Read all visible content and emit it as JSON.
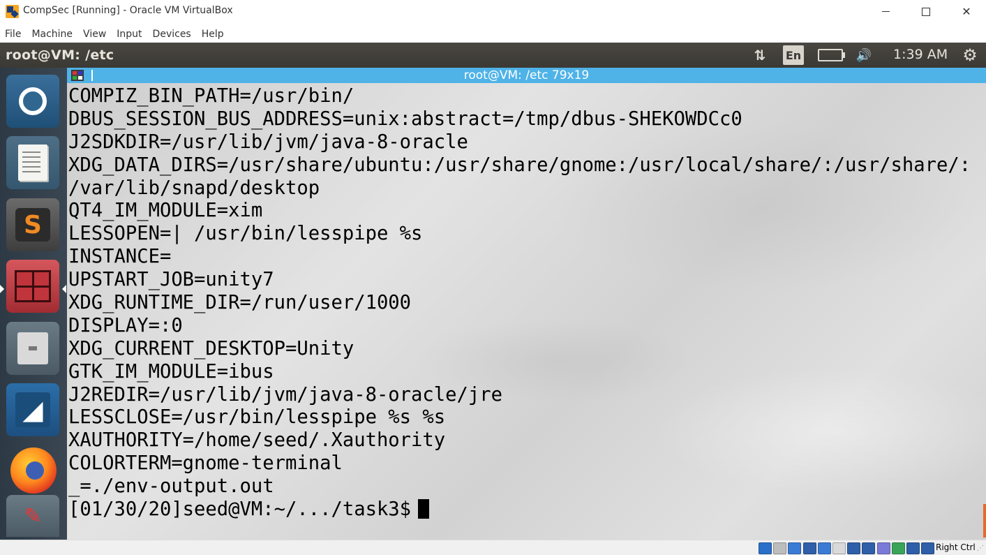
{
  "host_window": {
    "title": "CompSec [Running] - Oracle VM VirtualBox",
    "controls": {
      "minimize": "",
      "maximize": "",
      "close": "✕"
    }
  },
  "menubar": {
    "items": [
      "File",
      "Machine",
      "View",
      "Input",
      "Devices",
      "Help"
    ]
  },
  "ubuntu_panel": {
    "window_title": "root@VM: /etc",
    "network_glyph": "⇅",
    "language": "En",
    "volume_glyph": "🔊",
    "clock": "1:39 AM",
    "gear_glyph": "⚙"
  },
  "launcher": {
    "items": [
      {
        "name": "ubuntu-dash",
        "icon": "ubuntu-logo-icon"
      },
      {
        "name": "text-editor",
        "icon": "text-editor-icon"
      },
      {
        "name": "sublime-text",
        "icon": "sublime-text-icon",
        "glyph": "S"
      },
      {
        "name": "terminal",
        "icon": "terminal-icon",
        "active": true
      },
      {
        "name": "files",
        "icon": "files-icon"
      },
      {
        "name": "wireshark",
        "icon": "wireshark-icon"
      },
      {
        "name": "firefox",
        "icon": "firefox-icon"
      },
      {
        "name": "system-settings",
        "icon": "settings-icon"
      }
    ]
  },
  "terminal": {
    "title": "root@VM: /etc 79x19",
    "lines": [
      "COMPIZ_BIN_PATH=/usr/bin/",
      "DBUS_SESSION_BUS_ADDRESS=unix:abstract=/tmp/dbus-SHEKOWDCc0",
      "J2SDKDIR=/usr/lib/jvm/java-8-oracle",
      "XDG_DATA_DIRS=/usr/share/ubuntu:/usr/share/gnome:/usr/local/share/:/usr/share/:",
      "/var/lib/snapd/desktop",
      "QT4_IM_MODULE=xim",
      "LESSOPEN=| /usr/bin/lesspipe %s",
      "INSTANCE=",
      "UPSTART_JOB=unity7",
      "XDG_RUNTIME_DIR=/run/user/1000",
      "DISPLAY=:0",
      "XDG_CURRENT_DESKTOP=Unity",
      "GTK_IM_MODULE=ibus",
      "J2REDIR=/usr/lib/jvm/java-8-oracle/jre",
      "LESSCLOSE=/usr/bin/lesspipe %s %s",
      "XAUTHORITY=/home/seed/.Xauthority",
      "COLORTERM=gnome-terminal",
      "_=./env-output.out"
    ],
    "prompt": "[01/30/20]seed@VM:~/.../task3$"
  },
  "statusbar": {
    "host_key": "Right Ctrl",
    "icons": [
      "hard-disk-icon",
      "optical-drive-icon",
      "audio-icon",
      "network-icon",
      "usb-icon",
      "shared-folders-icon",
      "display-icon",
      "recording-icon",
      "cpu-icon",
      "virtualization-icon",
      "mouse-integration-icon",
      "keyboard-capture-icon"
    ],
    "icon_colors": [
      "#2a6fc9",
      "#bdbdbd",
      "#3a7bd5",
      "#2f5fa8",
      "#3a7bd5",
      "#d9d9d9",
      "#2f5fa8",
      "#2f5fa8",
      "#7a7ad9",
      "#3aa55a",
      "#2f5fa8",
      "#2f5fa8"
    ]
  }
}
